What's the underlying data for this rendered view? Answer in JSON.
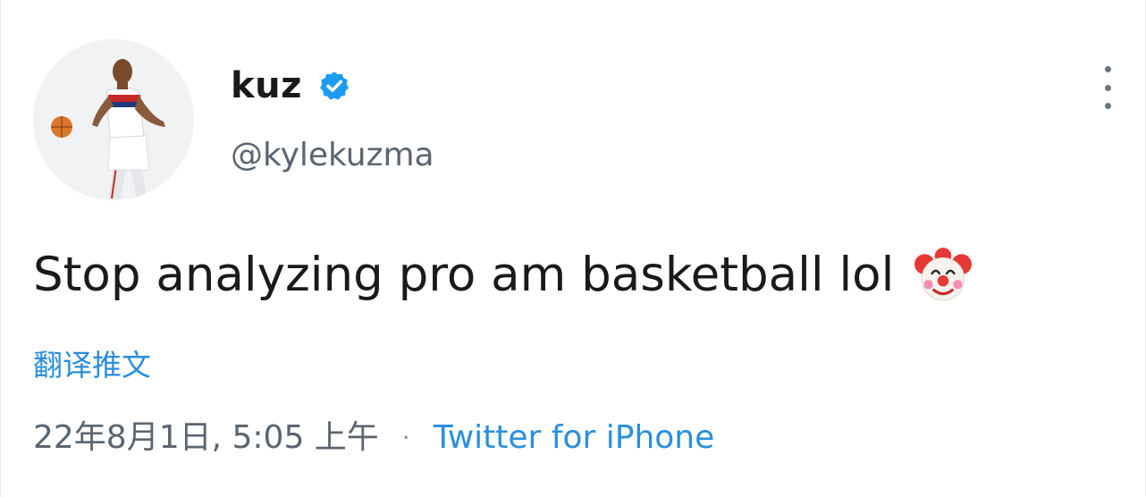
{
  "tweet": {
    "author": {
      "display_name": "kuz",
      "handle": "@kylekuzma",
      "verified": true,
      "avatar_icon": "player-avatar"
    },
    "text": "Stop analyzing pro am basketball lol",
    "emoji": "clown-face",
    "translate_label": "翻译推文",
    "timestamp": "22年8月1日, 5:05 上午",
    "separator": "·",
    "source": "Twitter for iPhone",
    "more_icon": "more-vertical-icon"
  },
  "colors": {
    "link": "#2b8fdc",
    "verified": "#1d9bf0",
    "secondary_text": "#5b6570",
    "primary_text": "#1a1a1a"
  }
}
